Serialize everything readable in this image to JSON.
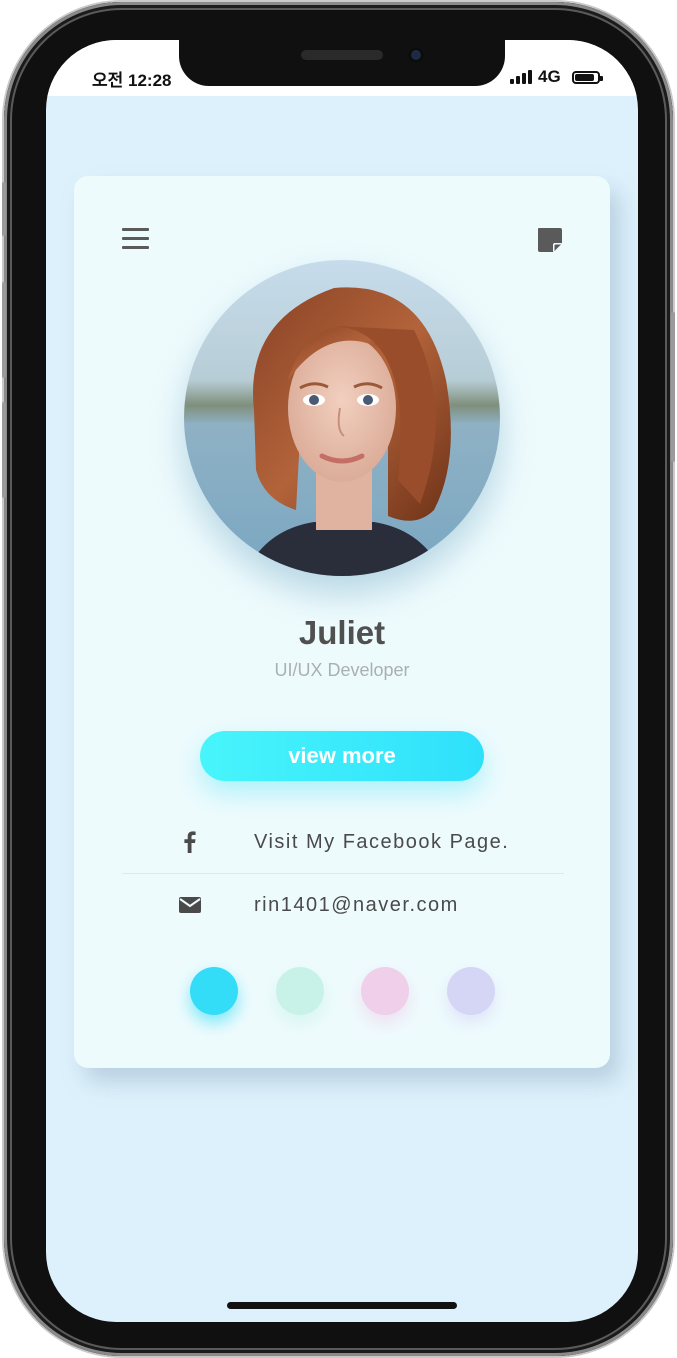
{
  "status_bar": {
    "time": "오전 12:28",
    "network": "4G",
    "battery_level": 0.85
  },
  "profile": {
    "name": "Juliet",
    "role": "UI/UX Developer",
    "view_more_label": "view more"
  },
  "contacts": [
    {
      "icon": "facebook-icon",
      "text": "Visit My Facebook Page."
    },
    {
      "icon": "envelope-icon",
      "text": "rin1401@naver.com"
    }
  ],
  "theme_colors": [
    "#33dcf7",
    "#c8f2e8",
    "#efcfe9",
    "#d5d5f6"
  ],
  "icons": {
    "menu": "hamburger-menu-icon",
    "note": "sticky-note-icon"
  }
}
